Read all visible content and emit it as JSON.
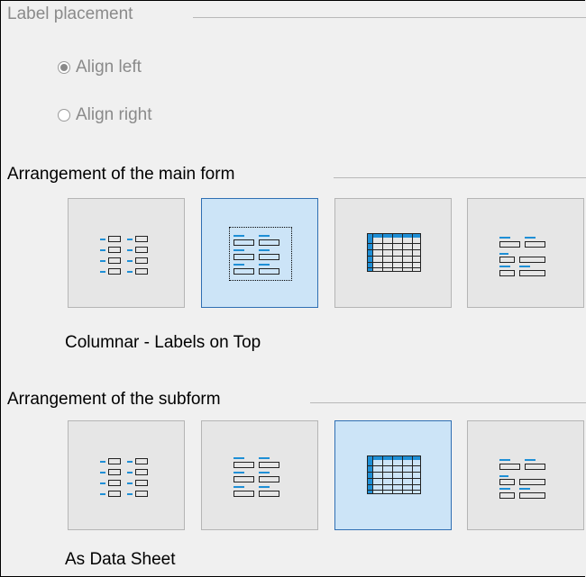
{
  "label_placement": {
    "title": "Label placement",
    "options": [
      {
        "label": "Align left",
        "checked": true
      },
      {
        "label": "Align right",
        "checked": false
      }
    ]
  },
  "main_form": {
    "title": "Arrangement of the main form",
    "selected_label": "Columnar - Labels on Top",
    "tiles": [
      {
        "icon": "columnar-labels-left-icon",
        "selected": false
      },
      {
        "icon": "columnar-labels-top-icon",
        "selected": true
      },
      {
        "icon": "data-sheet-icon",
        "selected": false
      },
      {
        "icon": "block-labels-above-icon",
        "selected": false
      }
    ]
  },
  "subform": {
    "title": "Arrangement of the subform",
    "selected_label": "As Data Sheet",
    "tiles": [
      {
        "icon": "columnar-labels-left-icon",
        "selected": false
      },
      {
        "icon": "columnar-labels-top-icon",
        "selected": false
      },
      {
        "icon": "data-sheet-icon",
        "selected": true
      },
      {
        "icon": "block-labels-above-icon",
        "selected": false
      }
    ]
  },
  "colors": {
    "accent_blue": "#1e8fd6",
    "selected_bg": "#cce4f7",
    "selected_border": "#2f6fb3"
  }
}
